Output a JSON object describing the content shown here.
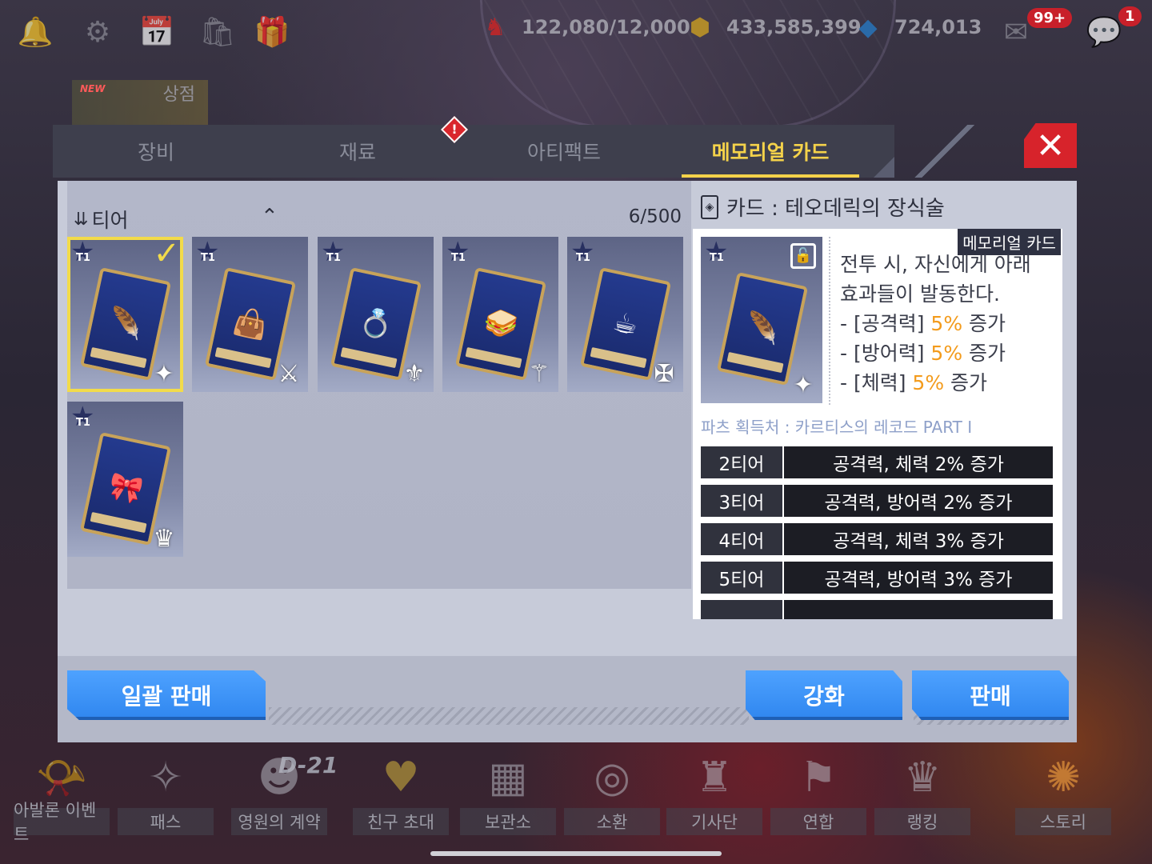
{
  "topbar": {
    "icons": [
      "bell-icon",
      "settings-icon",
      "calendar-icon",
      "bag-icon",
      "gift-icon"
    ],
    "stamina": "122,080/12,000",
    "gold": "433,585,399",
    "crystal": "724,013",
    "mail_badge": "99+",
    "chat_badge": "1"
  },
  "side": {
    "shop_label": "상점",
    "new_tag": "NEW"
  },
  "tabs": [
    {
      "label": "장비"
    },
    {
      "label": "재료"
    },
    {
      "label": "아티팩트"
    },
    {
      "label": "메모리얼 카드"
    }
  ],
  "tab_alert": "!",
  "close": "✕",
  "list": {
    "sort_label": "티어",
    "count": "6/500",
    "cards": [
      {
        "tier": "T1",
        "item": "🪶",
        "class": "✦",
        "selected": true
      },
      {
        "tier": "T1",
        "item": "👜",
        "class": "⚔"
      },
      {
        "tier": "T1",
        "item": "💍",
        "class": "⚜"
      },
      {
        "tier": "T1",
        "item": "🥪",
        "class": "⚚"
      },
      {
        "tier": "T1",
        "item": "☕",
        "class": "✠"
      },
      {
        "tier": "T1",
        "item": "🎀",
        "class": "♛"
      }
    ]
  },
  "detail": {
    "title": "카드 : 테오데릭의 장식술",
    "tag": "메모리얼 카드",
    "card_tier": "T1",
    "desc_line1": "전투 시, 자신에게 아래",
    "desc_line2": "효과들이 발동한다.",
    "stat1_label": "- [공격력] ",
    "stat1_value": "5%",
    "stat1_suffix": " 증가",
    "stat2_label": "- [방어력] ",
    "stat2_value": "5%",
    "stat2_suffix": " 증가",
    "stat3_label": "- [체력] ",
    "stat3_value": "5%",
    "stat3_suffix": " 증가",
    "source": "파츠 획득처 : 카르티스의 레코드 PART I",
    "tiers": [
      {
        "name": "2티어",
        "effect": "공격력, 체력 2% 증가"
      },
      {
        "name": "3티어",
        "effect": "공격력, 방어력 2% 증가"
      },
      {
        "name": "4티어",
        "effect": "공격력, 체력 3% 증가"
      },
      {
        "name": "5티어",
        "effect": "공격력, 방어력 3% 증가"
      }
    ]
  },
  "buttons": {
    "bulk_sell": "일괄 판매",
    "enhance": "강화",
    "sell": "판매"
  },
  "bottom_nav": {
    "d_day": "D-21",
    "items": [
      {
        "label": "아발론 이벤트",
        "icon": "horn-icon"
      },
      {
        "label": "패스",
        "icon": "pass-icon"
      },
      {
        "label": "영원의 계약",
        "icon": "contract-icon"
      },
      {
        "label": "친구 초대",
        "icon": "friend-icon"
      },
      {
        "label": "보관소",
        "icon": "storage-icon"
      },
      {
        "label": "소환",
        "icon": "summon-icon"
      },
      {
        "label": "기사단",
        "icon": "knights-icon"
      },
      {
        "label": "연합",
        "icon": "alliance-icon"
      },
      {
        "label": "랭킹",
        "icon": "ranking-icon"
      },
      {
        "label": "스토리",
        "icon": "story-icon"
      }
    ]
  },
  "colors": {
    "accent_yellow": "#f4d24a",
    "highlight_orange": "#f39b1c",
    "button_blue": "#3a93f7",
    "close_red": "#d7232b"
  }
}
